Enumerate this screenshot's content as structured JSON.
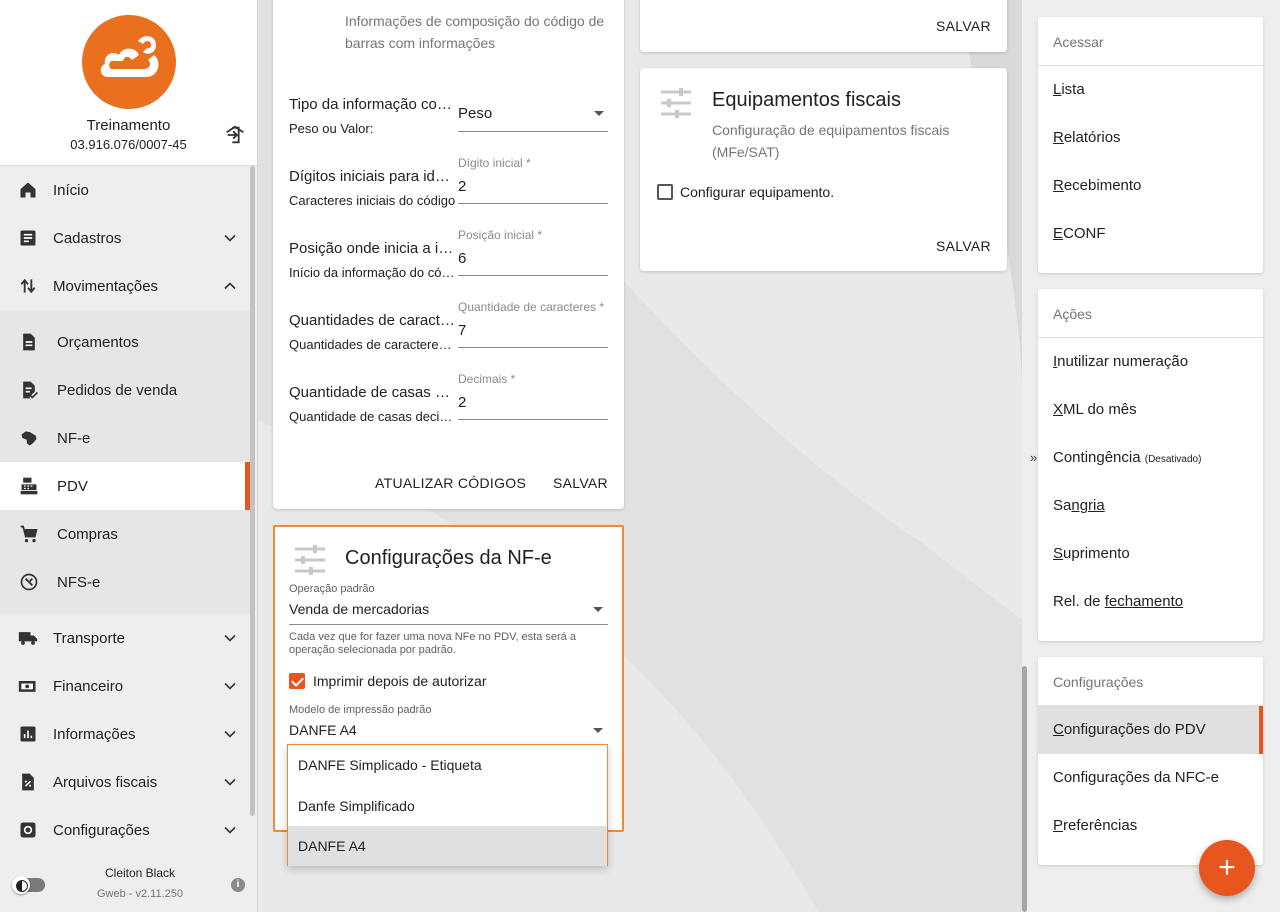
{
  "sidebar": {
    "company_name": "Treinamento",
    "company_id": "03.916.076/0007-45",
    "items": [
      {
        "label": "Início",
        "icon": "home-icon"
      },
      {
        "label": "Cadastros",
        "icon": "list-icon"
      },
      {
        "label": "Movimentações",
        "icon": "swap-icon"
      },
      {
        "label": "Orçamentos",
        "icon": "document-icon"
      },
      {
        "label": "Pedidos de venda",
        "icon": "document-check-icon"
      },
      {
        "label": "NF-e",
        "icon": "brazil-map-icon"
      },
      {
        "label": "PDV",
        "icon": "cash-register-icon"
      },
      {
        "label": "Compras",
        "icon": "cart-icon"
      },
      {
        "label": "NFS-e",
        "icon": "tools-icon"
      },
      {
        "label": "Transporte",
        "icon": "truck-icon"
      },
      {
        "label": "Financeiro",
        "icon": "money-icon"
      },
      {
        "label": "Informações",
        "icon": "chart-icon"
      },
      {
        "label": "Arquivos fiscais",
        "icon": "percent-file-icon"
      },
      {
        "label": "Configurações",
        "icon": "gear-icon"
      }
    ],
    "user_name": "Cleiton Black",
    "version": "Gweb - v2.11.250"
  },
  "barcode_card": {
    "description": "Informações de composição do código de barras com informações",
    "rows": [
      {
        "title": "Tipo da informação contida",
        "subtitle": "Peso ou Valor:",
        "field_label": "",
        "value": "Peso"
      },
      {
        "title": "Dígitos iniciais para identificação",
        "subtitle": "Caracteres iniciais do código",
        "field_label": "Dígito inicial *",
        "value": "2"
      },
      {
        "title": "Posição onde inicia a informação",
        "subtitle": "Início da informação do código",
        "field_label": "Posição inicial *",
        "value": "6"
      },
      {
        "title": "Quantidades de caracteres",
        "subtitle": "Quantidades de caracteres da informação",
        "field_label": "Quantidade de caracteres *",
        "value": "7"
      },
      {
        "title": "Quantidade de casas decimais",
        "subtitle": "Quantidade de casas decimais",
        "field_label": "Decimais *",
        "value": "2"
      }
    ],
    "btn_update": "ATUALIZAR CÓDIGOS",
    "btn_save": "SALVAR"
  },
  "nfe_card": {
    "title": "Configurações da NF-e",
    "operation_label": "Operação padrão",
    "operation_value": "Venda de mercadorias",
    "helper": "Cada vez que for fazer uma nova NFe no PDV, esta será a operação selecionada por padrão.",
    "print_checkbox_label": "Imprimir depois de autorizar",
    "print_checked": true,
    "model_label": "Modelo de impressão padrão",
    "model_value": "DANFE A4",
    "options": [
      "DANFE Simplicado - Etiqueta",
      "Danfe Simplificado",
      "DANFE A4"
    ]
  },
  "top_card": {
    "btn_save": "SALVAR"
  },
  "equipment_card": {
    "title": "Equipamentos fiscais",
    "description": "Configuração de equipamentos fiscais (MFe/SAT)",
    "checkbox_label": "Configurar equipamento.",
    "btn_save": "SALVAR"
  },
  "right_panel": {
    "access": {
      "header": "Acessar",
      "items": [
        {
          "first": "L",
          "rest": "ista"
        },
        {
          "first": "R",
          "rest": "elatórios"
        },
        {
          "first": "R",
          "rest": "ecebimento"
        },
        {
          "first": "E",
          "rest": "CONF"
        }
      ]
    },
    "actions": {
      "header": "Ações",
      "items": [
        {
          "first": "I",
          "rest": "nutilizar numeração",
          "suffix": ""
        },
        {
          "first": "X",
          "rest": "ML do mês",
          "suffix": ""
        },
        {
          "first": "Cont",
          "rest": "ingência",
          "suffix": "(Desativado)"
        },
        {
          "first": "Sa",
          "rest": "ngria",
          "suffix": ""
        },
        {
          "first": "S",
          "rest": "uprimento",
          "suffix": ""
        },
        {
          "first": "Rel. de ",
          "rest": "fechamento",
          "suffix": ""
        }
      ]
    },
    "settings": {
      "header": "Configurações",
      "items": [
        {
          "first": "C",
          "rest": "onfigurações do PDV"
        },
        {
          "first": "Con",
          "rest": "figurações da NFC-e"
        },
        {
          "first": "P",
          "rest": "referências"
        }
      ]
    }
  },
  "fab_label": "+",
  "double_chevron": "»",
  "colors": {
    "accent": "#e8561f",
    "logo": "#e8701f",
    "focus_border": "#ee8a3a"
  }
}
